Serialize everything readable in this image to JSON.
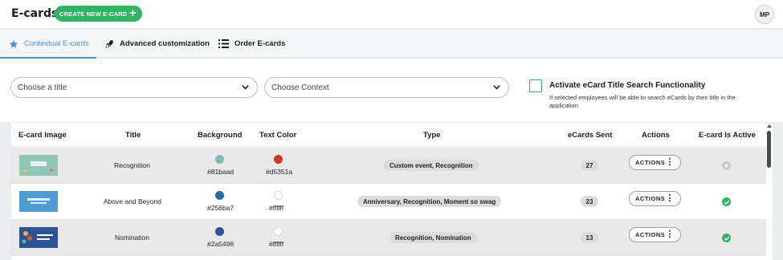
{
  "header": {
    "title": "E-cards",
    "create_button": "CREATE NEW E-CARD",
    "avatar_initials": "MP"
  },
  "tabs": [
    {
      "label": "Contextual E-cards",
      "icon": "star-icon",
      "active": true
    },
    {
      "label": "Advanced customization",
      "icon": "rocket-icon",
      "active": false
    },
    {
      "label": "Order E-cards",
      "icon": "list-icon",
      "active": false
    }
  ],
  "filters": {
    "title_select": "Choose a title",
    "context_select": "Choose Context",
    "search_toggle_label": "Activate eCard Title Search Functionality",
    "search_toggle_desc": "If selected employees will be able to search eCards by their title in the application",
    "search_toggle_checked": false
  },
  "table": {
    "columns": [
      "E-card Image",
      "Title",
      "Background",
      "Text Color",
      "Type",
      "eCards Sent",
      "Actions",
      "E-card Is Active"
    ],
    "rows": [
      {
        "title": "Recognition",
        "background": "#81baad",
        "text_color": "#d5351a",
        "type": "Custom event, Recognition",
        "sent": "27",
        "actions": "ACTIONS",
        "active": false,
        "thumb_color": "#8fc7b6"
      },
      {
        "title": "Above and Beyond",
        "background": "#256ba7",
        "text_color": "#ffffff",
        "type": "Anniversary, Recognition, Moment so swag",
        "sent": "23",
        "actions": "ACTIONS",
        "active": true,
        "thumb_color": "#5aa7d6"
      },
      {
        "title": "Nomination",
        "background": "#2a5496",
        "text_color": "#ffffff",
        "type": "Recognition, Nomination",
        "sent": "13",
        "actions": "ACTIONS",
        "active": true,
        "thumb_color": "#2a5496"
      }
    ]
  },
  "colors": {
    "accent_green": "#2fb464",
    "accent_blue": "#4a90d9"
  }
}
